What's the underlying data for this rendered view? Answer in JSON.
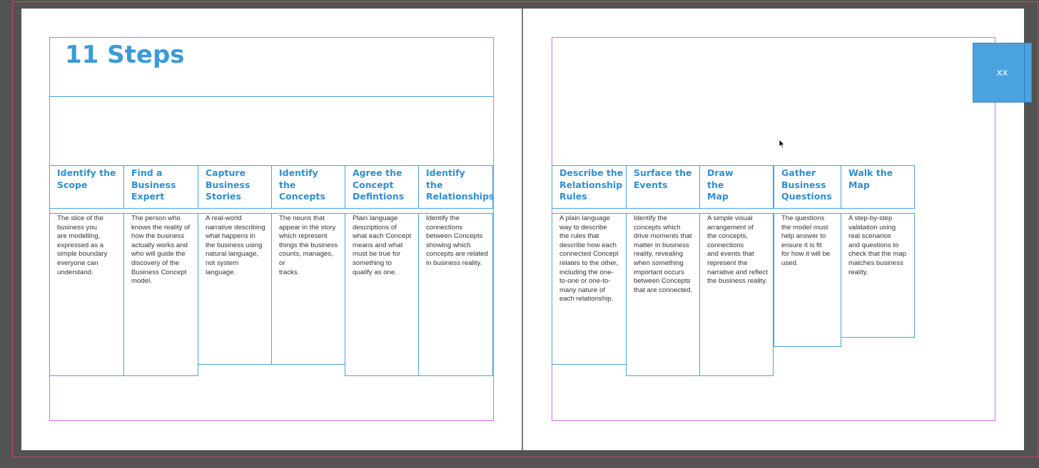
{
  "title": "11 Steps",
  "tab_label": "xx",
  "colors": {
    "pasteboard": "#535353",
    "page": "#ffffff",
    "margin_guide": "#d86bf0",
    "frame_border": "#4aa3df",
    "heading": "#2e8fd0",
    "tab_fill": "#4aa3df"
  },
  "left_steps": [
    {
      "heading": "Identify the\nScope",
      "body": "The slice of the\nbusiness you\nare modelling,\nexpressed as a\nsimple boundary\neveryone can\nunderstand."
    },
    {
      "heading": "Find a\nBusiness\nExpert",
      "body": "The person who\nknows the reality of\nhow the business\nactually works and\nwho will guide the\ndiscovery of the\nBusiness Concept\nmodel."
    },
    {
      "heading": "Capture\nBusiness\nStories",
      "body": "A real-world\nnarrative describing\nwhat happens in\nthe business using\nnatural language,\nnot system\nlanguage."
    },
    {
      "heading": "Identify\nthe\nConcepts",
      "body": "The nouns that\nappear in the story\nwhich represent\nthings the business\ncounts, manages, or\ntracks."
    },
    {
      "heading": "Agree the\nConcept\nDefintions",
      "body": "Plain language\ndescriptions of\nwhat each Concept\nmeans and what\nmust be true for\nsomething to\nqualify as one."
    },
    {
      "heading": "Identify\nthe\nRelationships",
      "body": "Identify the\nconnections\nbetween Concepts\nshowing which\nconcepts are related\nin business reality."
    }
  ],
  "right_steps": [
    {
      "heading": "Describe the\nRelationship\nRules",
      "body": "A plain language\nway to describe\nthe rules that\ndescribe how each\nconnected Concept\nrelates to the other,\nincluding the one-\nto-one or one-to-\nmany nature of\neach relationship."
    },
    {
      "heading": "Surface the\nEvents",
      "body": "Identify the\nconcepts which\ndrive moments that\nmatter in business\nreality, revealing\nwhen something\nimportant occurs\nbetween Concepts\nthat are connected."
    },
    {
      "heading": "Draw\nthe\nMap",
      "body": "A simple visual\narrangement of\nthe concepts,\nconnections\nand events that\nrepresent the\nnarrative and reflect\nthe business reality."
    },
    {
      "heading": "Gather\nBusiness\nQuestions",
      "body": "The questions\nthe model must\nhelp answer to\nensure it is fit\nfor how it will be\nused."
    },
    {
      "heading": "Walk the\nMap",
      "body": "A step-by-step\nvalidation using\nreal scenarios\nand questions to\ncheck that the map\nmatches business\nreality."
    }
  ]
}
